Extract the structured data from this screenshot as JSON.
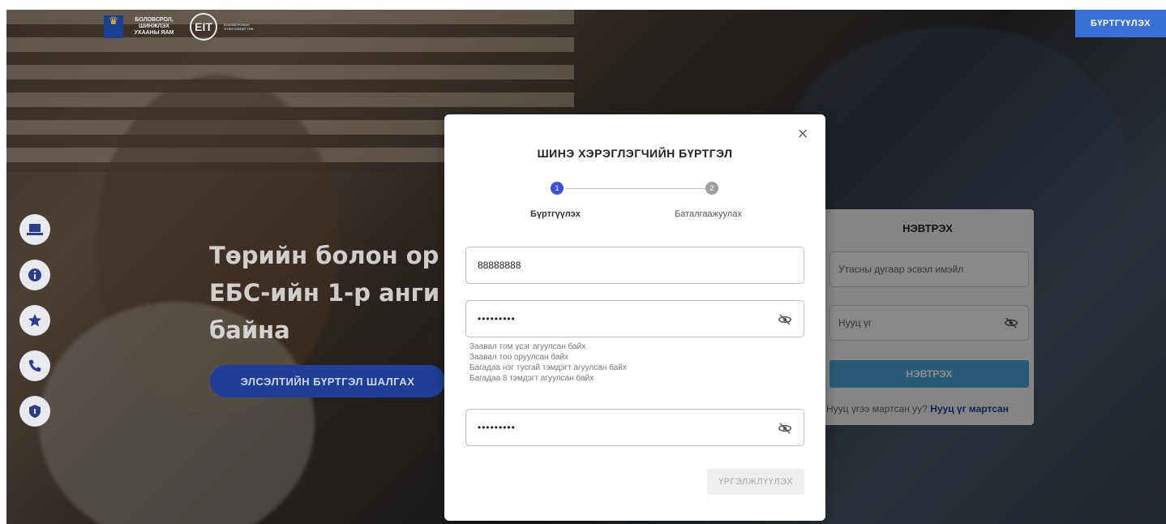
{
  "header": {
    "ministry_name": "БОЛОВСРОЛ, ШИНЖЛЭХ УХААНЫ ЯАМ",
    "eit_logo": "EIT",
    "eit_name": "БОЛОВСРОЛЫН ҮНЭЛГЭЭНИЙ ТӨВ",
    "register_button": "БҮРТГҮҮЛЭХ"
  },
  "side_icons": [
    "laptop-icon",
    "info-icon",
    "star-icon",
    "phone-icon",
    "shield-icon"
  ],
  "hero": {
    "line1": "Төрийн болон ор",
    "line2": "ЕБС-ийн 1-р анги",
    "line3": "байна",
    "button": "ЭЛСЭЛТИЙН БҮРТГЭЛ ШАЛГАХ"
  },
  "login": {
    "title": "НЭВТРЭХ",
    "username_placeholder": "Утасны дугаар эсвэл имэйл",
    "password_placeholder": "Нууц үг",
    "button": "НЭВТРЭХ",
    "forgot_prefix": "Нууц үгээ мартсан уу?",
    "forgot_link": "Нууц үг мартсан"
  },
  "modal": {
    "title": "ШИНЭ ХЭРЭГЛЭГЧИЙН БҮРТГЭЛ",
    "close_symbol": "×",
    "steps": [
      {
        "number": "1",
        "label": "Бүртгүүлэх",
        "active": true
      },
      {
        "number": "2",
        "label": "Баталгаажуулах",
        "active": false
      }
    ],
    "phone_value": "88888888",
    "password_value": "•••••••••",
    "password_hints": [
      "Заавал том үсэг агуулсан байх",
      "Заавал тоо оруулсан байх",
      "Багадаа нэг тусгай тэмдэгт агуулсан байх",
      "Багадаа 8 тэмдэгт агуулсан байх"
    ],
    "confirm_value": "•••••••••",
    "continue_button": "ҮРГЭЛЖЛҮҮЛЭХ"
  },
  "colors": {
    "step_active": "#3f51d8",
    "step_inactive": "#9e9e9e",
    "brand_blue": "#1f3f96",
    "login_button": "#4aa8d8"
  }
}
